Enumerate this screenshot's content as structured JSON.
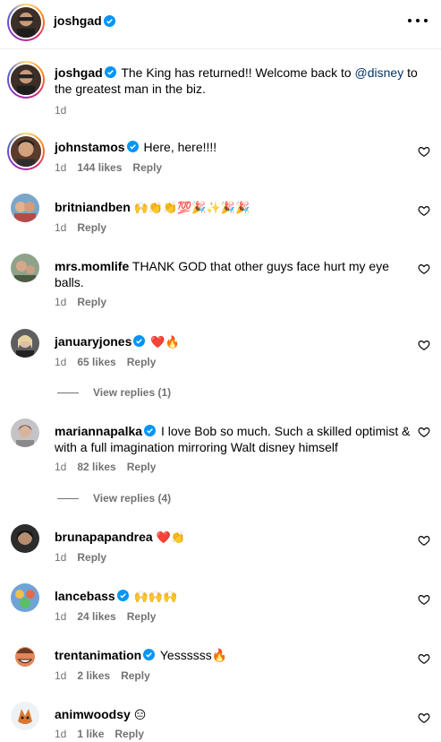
{
  "header": {
    "username": "joshgad"
  },
  "caption": {
    "username": "joshgad",
    "text_before": "The King has returned!! Welcome back to ",
    "mention": "@disney",
    "text_after": " to the greatest man in the biz.",
    "time": "1d"
  },
  "comments": [
    {
      "username": "johnstamos",
      "verified": true,
      "text": "Here, here!!!!",
      "time": "1d",
      "likes": "144 likes",
      "reply": "Reply"
    },
    {
      "username": "britniandben",
      "verified": false,
      "text": "🙌👏👏💯🎉✨🎉🎉",
      "time": "1d",
      "likes": "",
      "reply": "Reply"
    },
    {
      "username": "mrs.momlife",
      "verified": false,
      "text": "THANK GOD that other guys face hurt my eye balls.",
      "time": "1d",
      "likes": "",
      "reply": "Reply"
    },
    {
      "username": "januaryjones",
      "verified": true,
      "text": "❤️🔥",
      "time": "1d",
      "likes": "65 likes",
      "reply": "Reply",
      "view_replies": "View replies (1)"
    },
    {
      "username": "mariannapalka",
      "verified": true,
      "text": "I love Bob so much. Such a skilled optimist & with a full imagination mirroring Walt disney himself",
      "time": "1d",
      "likes": "82 likes",
      "reply": "Reply",
      "view_replies": "View replies (4)"
    },
    {
      "username": "brunapapandrea",
      "verified": false,
      "text": "❤️👏",
      "time": "1d",
      "likes": "",
      "reply": "Reply"
    },
    {
      "username": "lancebass",
      "verified": true,
      "text": "🙌🙌🙌",
      "time": "1d",
      "likes": "24 likes",
      "reply": "Reply"
    },
    {
      "username": "trentanimation",
      "verified": true,
      "text": "Yessssss🔥",
      "time": "1d",
      "likes": "2 likes",
      "reply": "Reply"
    },
    {
      "username": "animwoodsy",
      "verified": false,
      "text": "😑",
      "time": "1d",
      "likes": "1 like",
      "reply": "Reply"
    }
  ],
  "colors": {
    "verified": "#0095f6",
    "secondary_text": "#737373",
    "mention": "#00376b"
  }
}
